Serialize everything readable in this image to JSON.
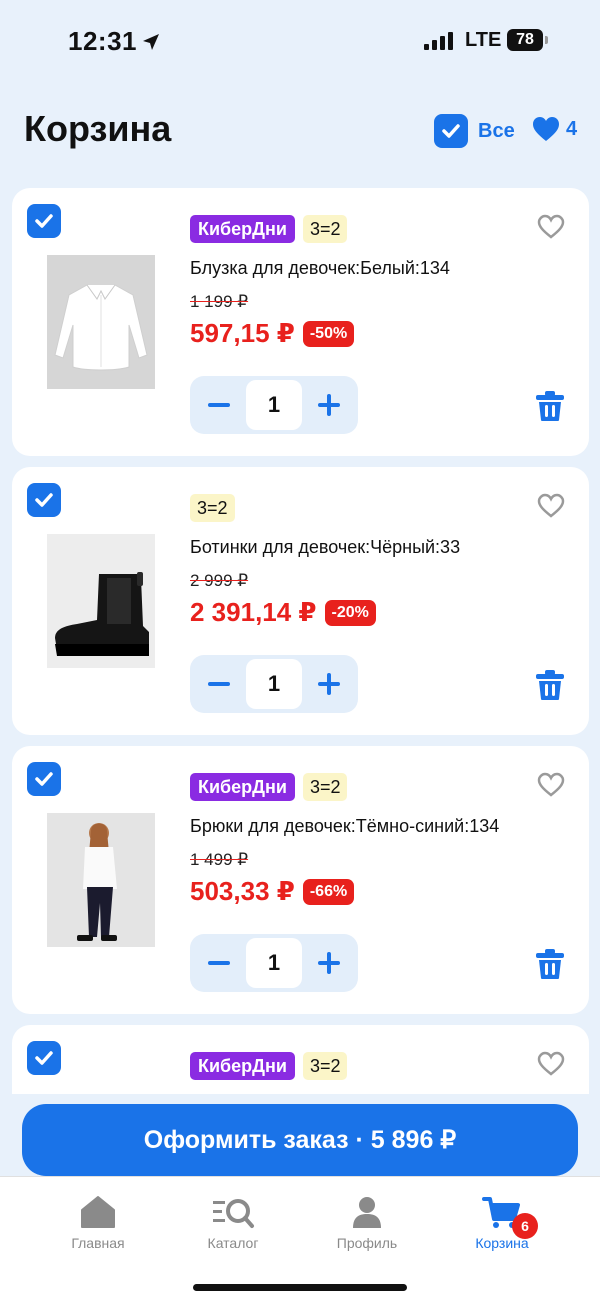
{
  "status": {
    "time": "12:31",
    "network": "LTE",
    "battery": "78"
  },
  "header": {
    "title": "Корзина",
    "select_all_label": "Все",
    "favorites_count": "4"
  },
  "items": [
    {
      "badges": [
        "КиберДни",
        "3=2"
      ],
      "name": "Блузка для девочек:Белый:134",
      "old_price": "1 199 ₽",
      "price": "597,15 ₽",
      "discount": "-50%",
      "quantity": "1",
      "image": "white-blouse"
    },
    {
      "badges": [
        "3=2"
      ],
      "name": "Ботинки для девочек:Чёрный:33",
      "old_price": "2 999 ₽",
      "price": "2 391,14 ₽",
      "discount": "-20%",
      "quantity": "1",
      "image": "black-boots"
    },
    {
      "badges": [
        "КиберДни",
        "3=2"
      ],
      "name": "Брюки для девочек:Тёмно-синий:134",
      "old_price": "1 499 ₽",
      "price": "503,33 ₽",
      "discount": "-66%",
      "quantity": "1",
      "image": "girl-in-trousers"
    },
    {
      "badges": [
        "КиберДни",
        "3=2"
      ]
    }
  ],
  "checkout": {
    "label": "Оформить заказ · 5 896 ₽"
  },
  "tabs": [
    {
      "label": "Главная",
      "icon": "home-icon"
    },
    {
      "label": "Каталог",
      "icon": "catalog-search-icon"
    },
    {
      "label": "Профиль",
      "icon": "profile-icon"
    },
    {
      "label": "Корзина",
      "icon": "cart-icon",
      "badge": "6"
    }
  ],
  "colors": {
    "accent": "#1a73e8",
    "sale": "#e8211d",
    "cyber_badge": "#8a2be2",
    "promo_badge": "#fbf5c8",
    "background": "#e8f1fb"
  }
}
